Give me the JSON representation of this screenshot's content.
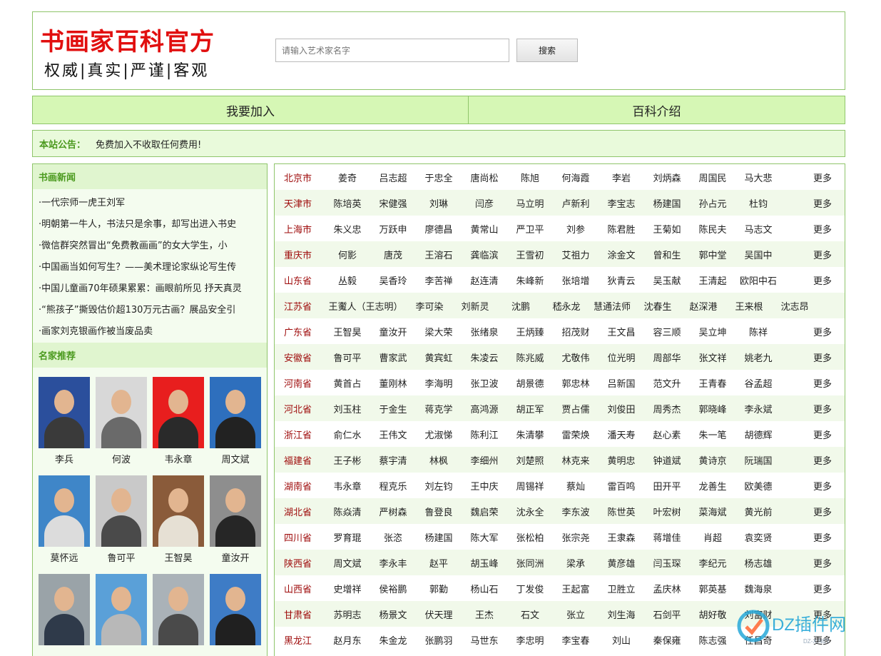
{
  "header": {
    "title": "书画家百科官方",
    "subtitle": "权威|真实|严谨|客观",
    "search_placeholder": "请输入艺术家名字",
    "search_button": "搜索"
  },
  "nav": [
    "我要加入",
    "百科介绍"
  ],
  "notice": {
    "label": "本站公告：",
    "text": "免费加入不收取任何费用!"
  },
  "news": {
    "title": "书画新闻",
    "items": [
      "·一代宗师一虎王刘军",
      "·明朝第一牛人，书法只是余事，却写出进入书史",
      "·微信群突然冒出“免费教画画”的女大学生，小",
      "·中国画当如何写生？——美术理论家纵论写生传",
      "·中国儿童画70年硕果累累：画眼前所见 抒天真灵",
      "·“熊孩子”撕毁估价超130万元古画？展品安全引",
      "·画家刘克银画作被当废品卖"
    ]
  },
  "featured": {
    "title": "名家推荐",
    "artists": [
      {
        "name": "李兵",
        "bg": "#2b4f9c",
        "shirt": "#3a3a3a"
      },
      {
        "name": "何波",
        "bg": "#d8d8d8",
        "shirt": "#6a6a6a"
      },
      {
        "name": "韦永章",
        "bg": "#e81e1e",
        "shirt": "#2a2a2a"
      },
      {
        "name": "周文斌",
        "bg": "#2e6fbd",
        "shirt": "#222222"
      },
      {
        "name": "莫怀远",
        "bg": "#3f86c8",
        "shirt": "#dcdcdc"
      },
      {
        "name": "鲁可平",
        "bg": "#c9c9c9",
        "shirt": "#4a4a4a"
      },
      {
        "name": "王智昊",
        "bg": "#8a5b3a",
        "shirt": "#e6e0d4"
      },
      {
        "name": "童汝开",
        "bg": "#8e8e8e",
        "shirt": "#262626"
      },
      {
        "name": "",
        "bg": "#9aa3a8",
        "shirt": "#2f3a4a"
      },
      {
        "name": "",
        "bg": "#5aa0d8",
        "shirt": "#b8b8b8"
      },
      {
        "name": "",
        "bg": "#aab2b8",
        "shirt": "#4a4a4a"
      },
      {
        "name": "",
        "bg": "#3e7cc6",
        "shirt": "#202020"
      }
    ]
  },
  "regions": [
    {
      "name": "北京市",
      "artists": [
        "姜奇",
        "吕志超",
        "于忠全",
        "唐尚松",
        "陈旭",
        "何海霞",
        "李岩",
        "刘炳森",
        "周国民",
        "马大悲"
      ],
      "more": "更多"
    },
    {
      "name": "天津市",
      "artists": [
        "陈培英",
        "宋健强",
        "刘琳",
        "闫彦",
        "马立明",
        "卢新利",
        "李宝志",
        "杨建国",
        "孙占元",
        "杜钧"
      ],
      "more": "更多"
    },
    {
      "name": "上海市",
      "artists": [
        "朱义忠",
        "万跃申",
        "廖德昌",
        "黄常山",
        "严卫平",
        "刘参",
        "陈君胜",
        "王菊如",
        "陈民夫",
        "马志文"
      ],
      "more": "更多"
    },
    {
      "name": "重庆市",
      "artists": [
        "何影",
        "唐茂",
        "王溶石",
        "龚临滨",
        "王雪初",
        "艾祖力",
        "涂金文",
        "曾和生",
        "郭中堂",
        "吴国中"
      ],
      "more": "更多"
    },
    {
      "name": "山东省",
      "artists": [
        "丛毅",
        "吴香玲",
        "李苦禅",
        "赵连清",
        "朱峰新",
        "张培增",
        "狄青云",
        "吴玉献",
        "王清起",
        "欧阳中石"
      ],
      "more": "更多"
    },
    {
      "name": "江苏省",
      "artists": [
        "王魙人（王志明）",
        "李可染",
        "刘新灵",
        "沈鹏",
        "嵇永龙",
        "慧通法师",
        "沈春生",
        "赵深港",
        "王来根",
        "沈志昂"
      ],
      "more": ""
    },
    {
      "name": "广东省",
      "artists": [
        "王智昊",
        "童汝开",
        "梁大荣",
        "张绪泉",
        "王炳臻",
        "招茂财",
        "王文昌",
        "容三顺",
        "吴立坤",
        "陈祥"
      ],
      "more": "更多"
    },
    {
      "name": "安徽省",
      "artists": [
        "鲁可平",
        "曹家武",
        "黄宾虹",
        "朱凌云",
        "陈兆威",
        "尤敬伟",
        "位光明",
        "周部华",
        "张文祥",
        "姚老九"
      ],
      "more": "更多"
    },
    {
      "name": "河南省",
      "artists": [
        "黄首占",
        "董刚林",
        "李海明",
        "张卫波",
        "胡景德",
        "郭忠林",
        "吕新国",
        "范文升",
        "王青春",
        "谷孟超"
      ],
      "more": "更多"
    },
    {
      "name": "河北省",
      "artists": [
        "刘玉柱",
        "于金生",
        "蒋克学",
        "高鸿源",
        "胡正军",
        "贾占儒",
        "刘俊田",
        "周秀杰",
        "郭晓峰",
        "李永斌"
      ],
      "more": "更多"
    },
    {
      "name": "浙江省",
      "artists": [
        "俞仁水",
        "王伟文",
        "尤淑悌",
        "陈利江",
        "朱清攀",
        "雷荣焕",
        "潘天寿",
        "赵心素",
        "朱一笔",
        "胡德辉"
      ],
      "more": "更多"
    },
    {
      "name": "福建省",
      "artists": [
        "王子彬",
        "蔡宇清",
        "林枫",
        "李细州",
        "刘楚照",
        "林克来",
        "黄明忠",
        "钟道斌",
        "黄诗京",
        "阮瑞国"
      ],
      "more": "更多"
    },
    {
      "name": "湖南省",
      "artists": [
        "韦永章",
        "程克乐",
        "刘左钧",
        "王中庆",
        "周锡祥",
        "蔡灿",
        "雷百鸣",
        "田开平",
        "龙善生",
        "欧美德"
      ],
      "more": "更多"
    },
    {
      "name": "湖北省",
      "artists": [
        "陈焱清",
        "严树森",
        "鲁登良",
        "魏启荣",
        "沈永全",
        "李东波",
        "陈世英",
        "叶宏树",
        "菜海斌",
        "黄光前"
      ],
      "more": "更多"
    },
    {
      "name": "四川省",
      "artists": [
        "罗育琨",
        "张恣",
        "杨建国",
        "陈大军",
        "张松柏",
        "张宗尧",
        "王隶森",
        "蒋增佳",
        "肖超",
        "袁奕贤"
      ],
      "more": "更多"
    },
    {
      "name": "陕西省",
      "artists": [
        "周文斌",
        "李永丰",
        "赵平",
        "胡玉峰",
        "张同洲",
        "梁承",
        "黄彦雄",
        "闫玉琛",
        "李纪元",
        "杨志雄"
      ],
      "more": "更多"
    },
    {
      "name": "山西省",
      "artists": [
        "史增祥",
        "侯裕鹏",
        "郭勤",
        "杨山石",
        "丁发俊",
        "王起富",
        "卫胜立",
        "孟庆林",
        "郭英基",
        "魏海泉"
      ],
      "more": "更多"
    },
    {
      "name": "甘肃省",
      "artists": [
        "苏明志",
        "杨景文",
        "伏天理",
        "王杰",
        "石文",
        "张立",
        "刘生海",
        "石剑平",
        "胡好敬",
        "刘富财"
      ],
      "more": "更多"
    },
    {
      "name": "黑龙江",
      "artists": [
        "赵月东",
        "朱金龙",
        "张鹏羽",
        "马世东",
        "李忠明",
        "李宝春",
        "刘山",
        "秦保雍",
        "陈志强",
        "任昌奇"
      ],
      "more": "更多"
    }
  ],
  "watermark": {
    "text": "DZ插件网",
    "small": "DZ-X.NET",
    "color": "#27a8d8"
  }
}
